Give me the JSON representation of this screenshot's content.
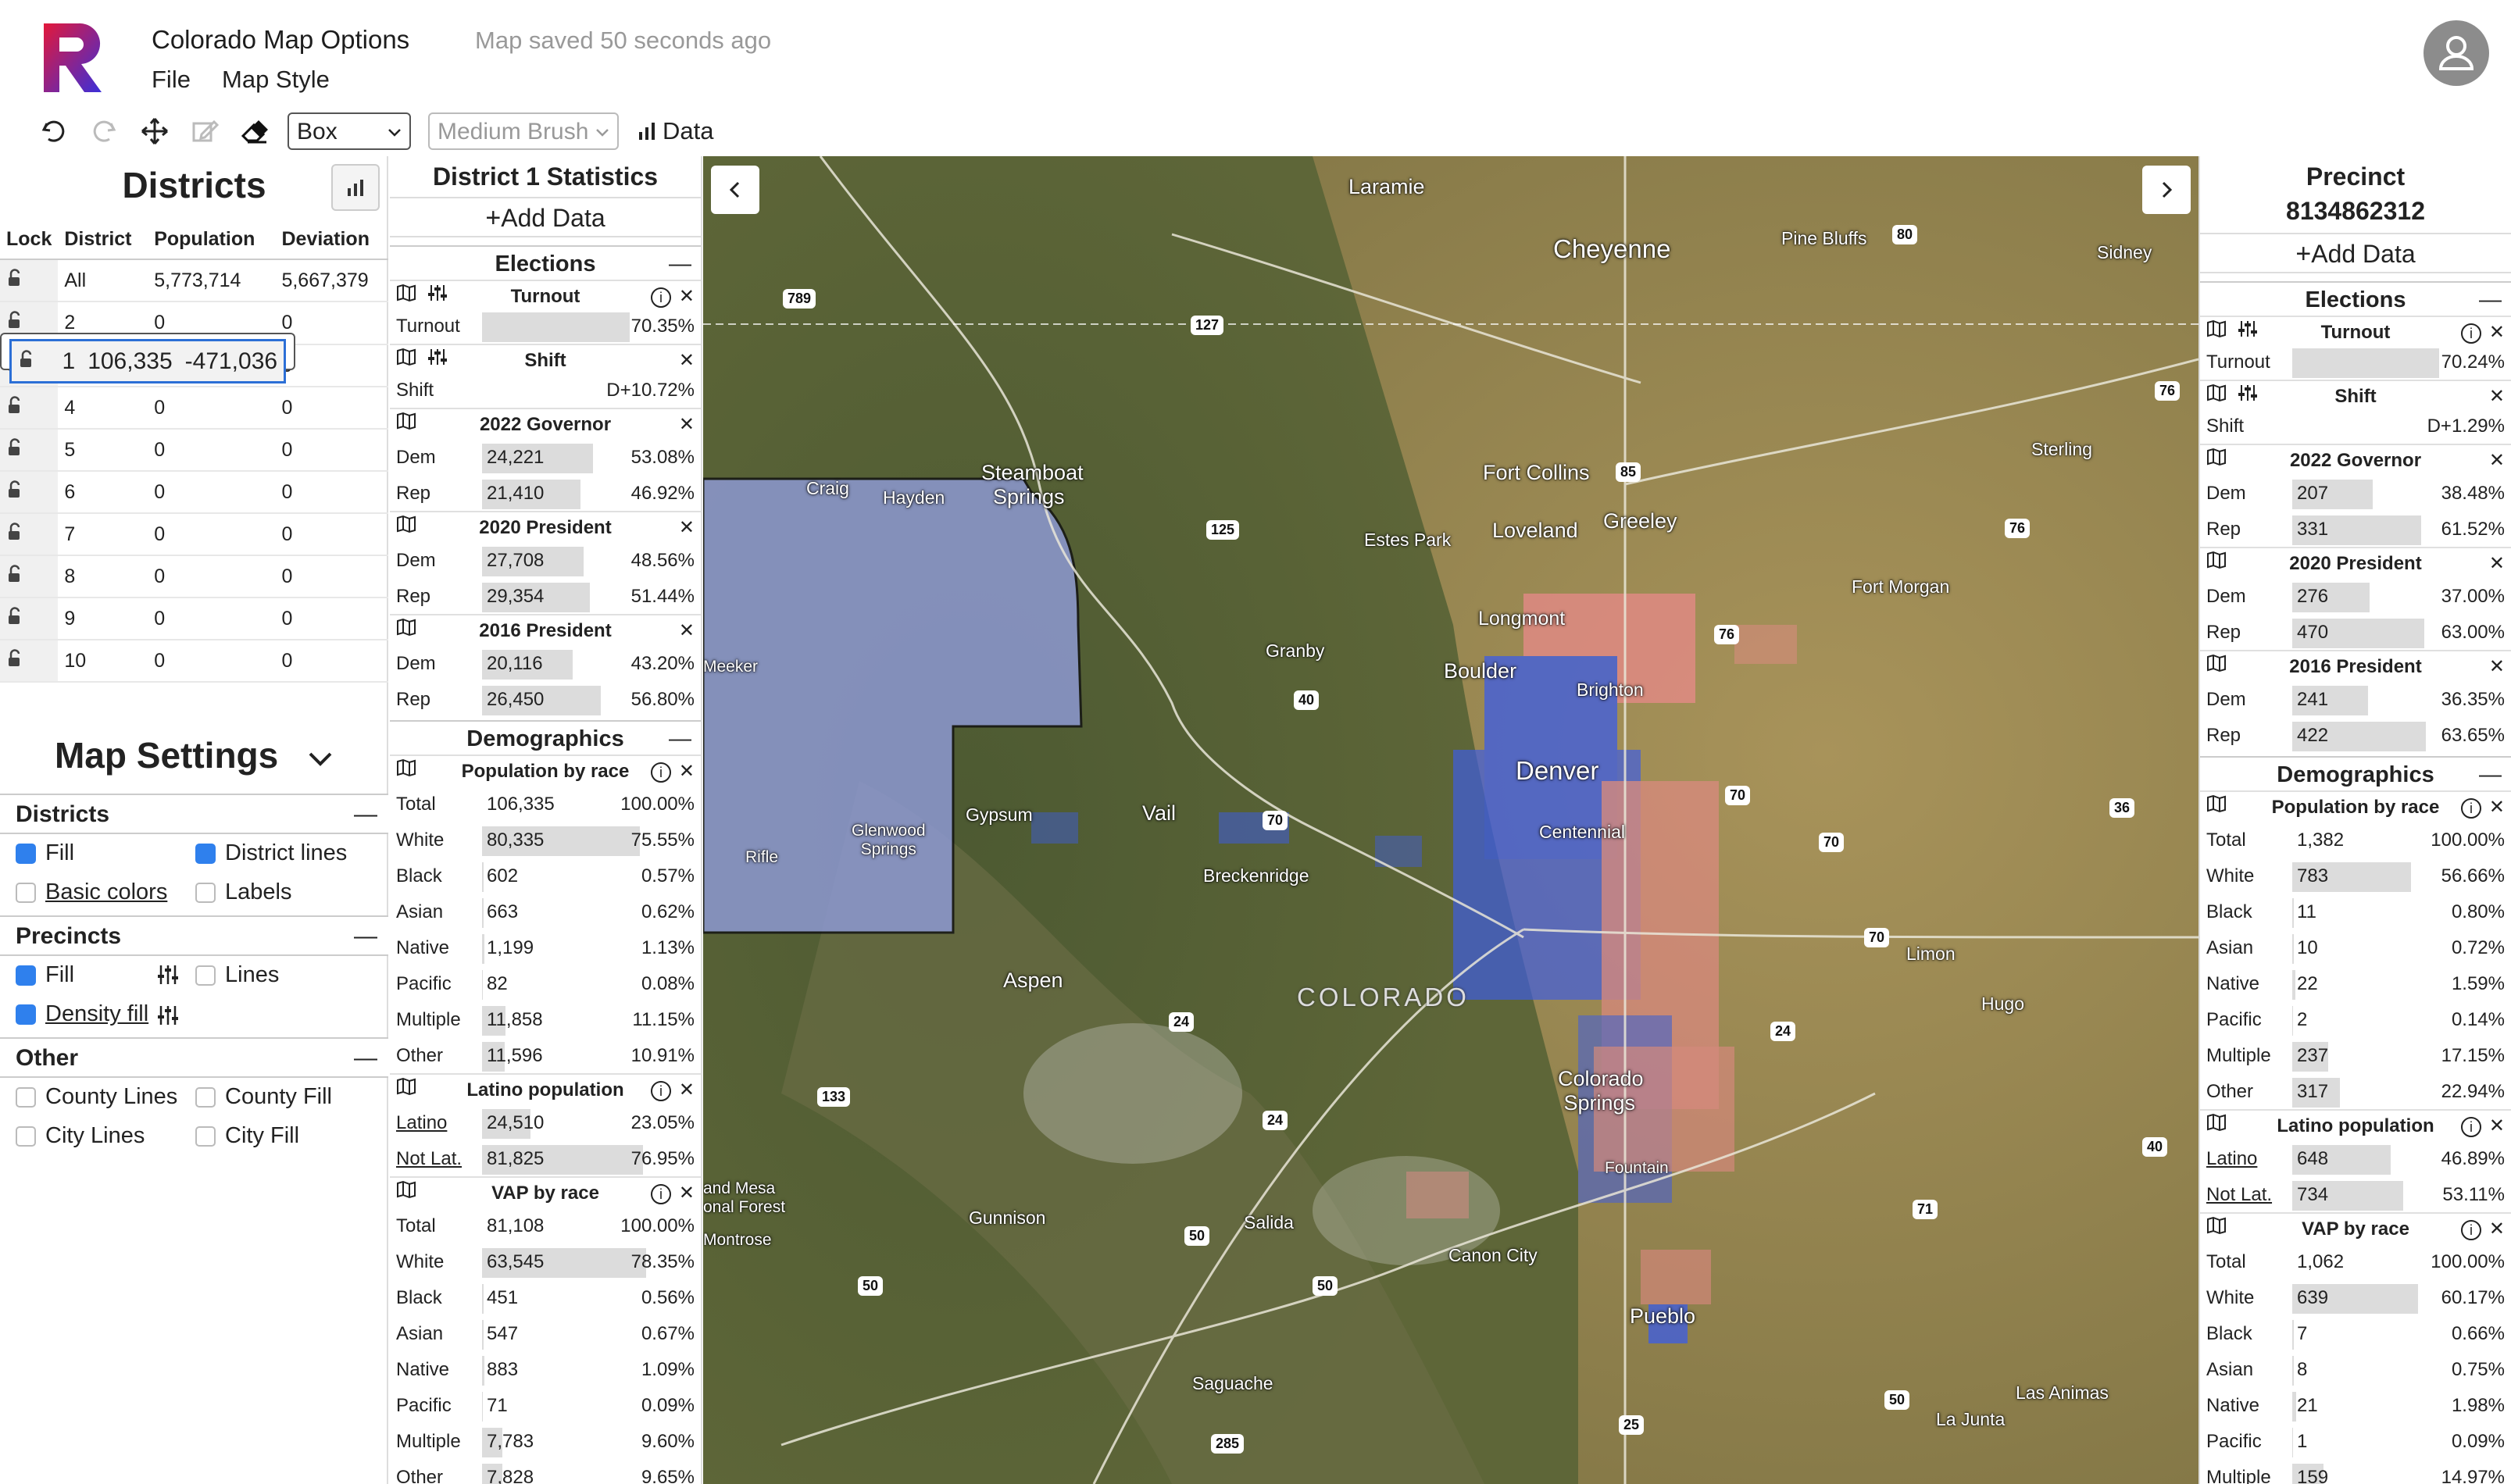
{
  "app": {
    "title": "Colorado Map Options",
    "saved_status": "Map saved 50 seconds ago",
    "menu": [
      "File",
      "Map Style"
    ]
  },
  "toolbar": {
    "tool_select": "Box",
    "brush_select": "Medium Brush",
    "data_label": "Data"
  },
  "districts": {
    "title": "Districts",
    "columns": [
      "Lock",
      "District",
      "Population",
      "Deviation"
    ],
    "rows": [
      {
        "district": "All",
        "population": "5,773,714",
        "deviation": "5,667,379"
      },
      {
        "district": "1",
        "population": "106,335",
        "deviation": "-471,036"
      },
      {
        "district": "2",
        "population": "0",
        "deviation": "0"
      },
      {
        "district": "3",
        "population": "0",
        "deviation": "0"
      },
      {
        "district": "4",
        "population": "0",
        "deviation": "0"
      },
      {
        "district": "5",
        "population": "0",
        "deviation": "0"
      },
      {
        "district": "6",
        "population": "0",
        "deviation": "0"
      },
      {
        "district": "7",
        "population": "0",
        "deviation": "0"
      },
      {
        "district": "8",
        "population": "0",
        "deviation": "0"
      },
      {
        "district": "9",
        "population": "0",
        "deviation": "0"
      },
      {
        "district": "10",
        "population": "0",
        "deviation": "0"
      }
    ],
    "selected_index": 1
  },
  "map_settings": {
    "title": "Map Settings",
    "districts": {
      "heading": "Districts",
      "fill": "Fill",
      "district_lines": "District lines",
      "basic_colors": "Basic colors",
      "labels": "Labels"
    },
    "precincts": {
      "heading": "Precincts",
      "fill": "Fill",
      "lines": "Lines",
      "density_fill": "Density fill"
    },
    "other": {
      "heading": "Other",
      "county_lines": "County Lines",
      "county_fill": "County Fill",
      "city_lines": "City Lines",
      "city_fill": "City Fill"
    }
  },
  "district_stats": {
    "title": "District 1 Statistics",
    "add_data": "Add Data",
    "elections_heading": "Elections",
    "turnout": {
      "title": "Turnout",
      "label": "Turnout",
      "value": "70.35%",
      "fraction": 0.7035
    },
    "shift": {
      "title": "Shift",
      "label": "Shift",
      "value": "D+10.72%"
    },
    "races": [
      {
        "title": "2022 Governor",
        "rows": [
          {
            "label": "Dem",
            "num": "24,221",
            "pct": "53.08%",
            "fraction": 0.5308
          },
          {
            "label": "Rep",
            "num": "21,410",
            "pct": "46.92%",
            "fraction": 0.4692
          }
        ]
      },
      {
        "title": "2020 President",
        "rows": [
          {
            "label": "Dem",
            "num": "27,708",
            "pct": "48.56%",
            "fraction": 0.4856
          },
          {
            "label": "Rep",
            "num": "29,354",
            "pct": "51.44%",
            "fraction": 0.5144
          }
        ]
      },
      {
        "title": "2016 President",
        "rows": [
          {
            "label": "Dem",
            "num": "20,116",
            "pct": "43.20%",
            "fraction": 0.432
          },
          {
            "label": "Rep",
            "num": "26,450",
            "pct": "56.80%",
            "fraction": 0.568
          }
        ]
      }
    ],
    "demographics_heading": "Demographics",
    "pop_by_race": {
      "title": "Population by race",
      "rows": [
        {
          "label": "Total",
          "num": "106,335",
          "pct": "100.00%",
          "fraction": 0
        },
        {
          "label": "White",
          "num": "80,335",
          "pct": "75.55%",
          "fraction": 0.7555
        },
        {
          "label": "Black",
          "num": "602",
          "pct": "0.57%",
          "fraction": 0.0057
        },
        {
          "label": "Asian",
          "num": "663",
          "pct": "0.62%",
          "fraction": 0.0062
        },
        {
          "label": "Native",
          "num": "1,199",
          "pct": "1.13%",
          "fraction": 0.0113
        },
        {
          "label": "Pacific",
          "num": "82",
          "pct": "0.08%",
          "fraction": 0.0008
        },
        {
          "label": "Multiple",
          "num": "11,858",
          "pct": "11.15%",
          "fraction": 0.1115
        },
        {
          "label": "Other",
          "num": "11,596",
          "pct": "10.91%",
          "fraction": 0.1091
        }
      ]
    },
    "latino": {
      "title": "Latino population",
      "rows": [
        {
          "label": "Latino",
          "num": "24,510",
          "pct": "23.05%",
          "fraction": 0.2305
        },
        {
          "label": "Not Lat.",
          "num": "81,825",
          "pct": "76.95%",
          "fraction": 0.7695
        }
      ]
    },
    "vap": {
      "title": "VAP by race",
      "rows": [
        {
          "label": "Total",
          "num": "81,108",
          "pct": "100.00%",
          "fraction": 0
        },
        {
          "label": "White",
          "num": "63,545",
          "pct": "78.35%",
          "fraction": 0.7835
        },
        {
          "label": "Black",
          "num": "451",
          "pct": "0.56%",
          "fraction": 0.0056
        },
        {
          "label": "Asian",
          "num": "547",
          "pct": "0.67%",
          "fraction": 0.0067
        },
        {
          "label": "Native",
          "num": "883",
          "pct": "1.09%",
          "fraction": 0.0109
        },
        {
          "label": "Pacific",
          "num": "71",
          "pct": "0.09%",
          "fraction": 0.0009
        },
        {
          "label": "Multiple",
          "num": "7,783",
          "pct": "9.60%",
          "fraction": 0.096
        },
        {
          "label": "Other",
          "num": "7,828",
          "pct": "9.65%",
          "fraction": 0.0965
        }
      ]
    }
  },
  "precinct_stats": {
    "title": "Precinct",
    "precinct_id": "8134862312",
    "add_data": "Add Data",
    "elections_heading": "Elections",
    "turnout": {
      "title": "Turnout",
      "label": "Turnout",
      "value": "70.24%",
      "fraction": 0.7024
    },
    "shift": {
      "title": "Shift",
      "label": "Shift",
      "value": "D+1.29%"
    },
    "races": [
      {
        "title": "2022 Governor",
        "rows": [
          {
            "label": "Dem",
            "num": "207",
            "pct": "38.48%",
            "fraction": 0.3848
          },
          {
            "label": "Rep",
            "num": "331",
            "pct": "61.52%",
            "fraction": 0.6152
          }
        ]
      },
      {
        "title": "2020 President",
        "rows": [
          {
            "label": "Dem",
            "num": "276",
            "pct": "37.00%",
            "fraction": 0.37
          },
          {
            "label": "Rep",
            "num": "470",
            "pct": "63.00%",
            "fraction": 0.63
          }
        ]
      },
      {
        "title": "2016 President",
        "rows": [
          {
            "label": "Dem",
            "num": "241",
            "pct": "36.35%",
            "fraction": 0.3635
          },
          {
            "label": "Rep",
            "num": "422",
            "pct": "63.65%",
            "fraction": 0.6365
          }
        ]
      }
    ],
    "demographics_heading": "Demographics",
    "pop_by_race": {
      "title": "Population by race",
      "rows": [
        {
          "label": "Total",
          "num": "1,382",
          "pct": "100.00%",
          "fraction": 0
        },
        {
          "label": "White",
          "num": "783",
          "pct": "56.66%",
          "fraction": 0.5666
        },
        {
          "label": "Black",
          "num": "11",
          "pct": "0.80%",
          "fraction": 0.008
        },
        {
          "label": "Asian",
          "num": "10",
          "pct": "0.72%",
          "fraction": 0.0072
        },
        {
          "label": "Native",
          "num": "22",
          "pct": "1.59%",
          "fraction": 0.0159
        },
        {
          "label": "Pacific",
          "num": "2",
          "pct": "0.14%",
          "fraction": 0.0014
        },
        {
          "label": "Multiple",
          "num": "237",
          "pct": "17.15%",
          "fraction": 0.1715
        },
        {
          "label": "Other",
          "num": "317",
          "pct": "22.94%",
          "fraction": 0.2294
        }
      ]
    },
    "latino": {
      "title": "Latino population",
      "rows": [
        {
          "label": "Latino",
          "num": "648",
          "pct": "46.89%",
          "fraction": 0.4689
        },
        {
          "label": "Not Lat.",
          "num": "734",
          "pct": "53.11%",
          "fraction": 0.5311
        }
      ]
    },
    "vap": {
      "title": "VAP by race",
      "rows": [
        {
          "label": "Total",
          "num": "1,062",
          "pct": "100.00%",
          "fraction": 0
        },
        {
          "label": "White",
          "num": "639",
          "pct": "60.17%",
          "fraction": 0.6017
        },
        {
          "label": "Black",
          "num": "7",
          "pct": "0.66%",
          "fraction": 0.0066
        },
        {
          "label": "Asian",
          "num": "8",
          "pct": "0.75%",
          "fraction": 0.0075
        },
        {
          "label": "Native",
          "num": "21",
          "pct": "1.98%",
          "fraction": 0.0198
        },
        {
          "label": "Pacific",
          "num": "1",
          "pct": "0.09%",
          "fraction": 0.0009
        },
        {
          "label": "Multiple",
          "num": "159",
          "pct": "14.97%",
          "fraction": 0.1497
        }
      ]
    }
  },
  "map": {
    "cities": [
      "Laramie",
      "Cheyenne",
      "Pine Bluffs",
      "Sidney",
      "Sterling",
      "Fort Collins",
      "Greeley",
      "Loveland",
      "Estes Park",
      "Fort Morgan",
      "Longmont",
      "Granby",
      "Boulder",
      "Brighton",
      "Denver",
      "Centennial",
      "Steamboat Springs",
      "Craig",
      "Hayden",
      "Meeker",
      "Rifle",
      "Glenwood Springs",
      "Gypsum",
      "Vail",
      "Breckenridge",
      "Aspen",
      "Limon",
      "Hugo",
      "COLORADO",
      "Colorado Springs",
      "Fountain",
      "Gunnison",
      "Salida",
      "Canon City",
      "Montrose",
      "Pueblo",
      "Saguache",
      "Las Animas",
      "La Junta",
      "Grand Mesa National Forest"
    ],
    "highways": [
      "789",
      "127",
      "80",
      "76",
      "85",
      "125",
      "76",
      "76",
      "40",
      "70",
      "70",
      "70",
      "36",
      "70",
      "24",
      "24",
      "133",
      "24",
      "40",
      "71",
      "50",
      "50",
      "50",
      "285",
      "25",
      "50"
    ],
    "colors": {
      "district_fill": "#8f9bd8",
      "dem": "#3d5ce6",
      "rep": "#e88a8a"
    }
  }
}
